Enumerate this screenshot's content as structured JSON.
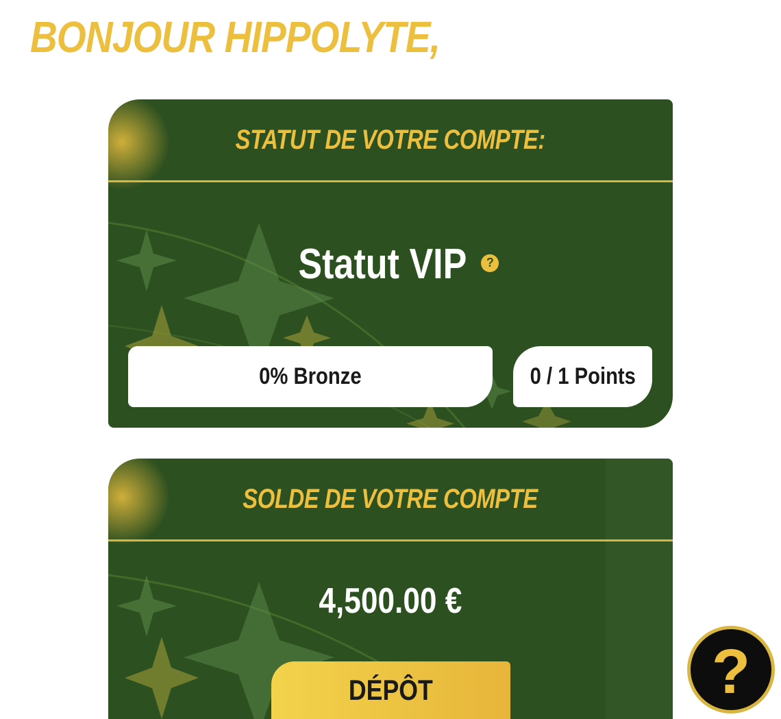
{
  "greeting": "BONJOUR HIPPOLYTE,",
  "status_card": {
    "title": "STATUT DE VOTRE COMPTE:",
    "vip_title": "Statut VIP",
    "help_glyph": "?",
    "progress_label": "0% Bronze",
    "points_label": "0 / 1 Points"
  },
  "balance_card": {
    "title": "SOLDE DE VOTRE COMPTE",
    "amount": "4,500.00 €",
    "deposit_label": "DÉPÔT"
  },
  "help_button": {
    "glyph": "?",
    "icon": "question-mark-icon"
  },
  "colors": {
    "card_green": "#2d5020",
    "accent_gold": "#ecbf3f",
    "white": "#ffffff",
    "dark": "#0d0d0d"
  }
}
